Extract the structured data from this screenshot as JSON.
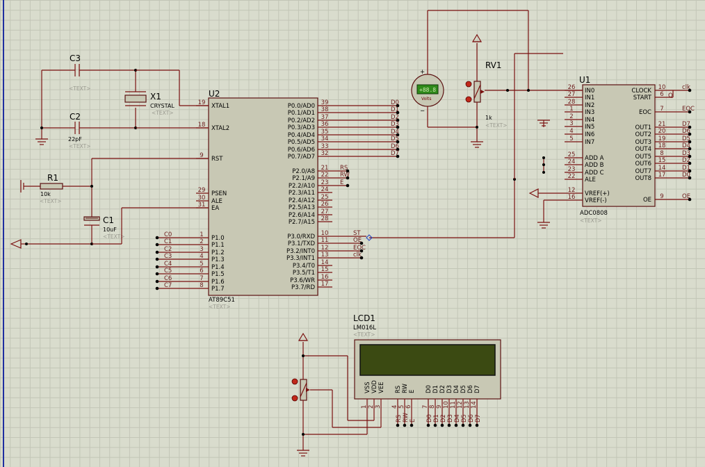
{
  "text_placeholder": "<TEXT>",
  "colors": {
    "wire": "#7a1010",
    "body": "#c8c8b4",
    "lcd": "#3b4a12",
    "meter": "#2f8a1a"
  },
  "c3": {
    "ref": "C3"
  },
  "c2": {
    "ref": "C2",
    "value": "22pF"
  },
  "x1": {
    "ref": "X1",
    "value": "CRYSTAL"
  },
  "r1": {
    "ref": "R1",
    "value": "10k"
  },
  "c1": {
    "ref": "C1",
    "value": "10uF"
  },
  "rv1": {
    "ref": "RV1",
    "value": "1k"
  },
  "voltmeter": {
    "reading": "+88.8",
    "unit": "Volts",
    "plus": "+",
    "minus": "−"
  },
  "u2": {
    "ref": "U2",
    "part": "AT89C51",
    "left_pins": [
      {
        "num": "19",
        "name": "XTAL1"
      },
      {
        "num": "18",
        "name": "XTAL2"
      },
      {
        "num": "9",
        "name": "RST"
      },
      {
        "num": "29",
        "name": "PSEN"
      },
      {
        "num": "30",
        "name": "ALE"
      },
      {
        "num": "31",
        "name": "EA"
      },
      {
        "num": "1",
        "name": "P1.0"
      },
      {
        "num": "2",
        "name": "P1.1"
      },
      {
        "num": "3",
        "name": "P1.2"
      },
      {
        "num": "4",
        "name": "P1.3"
      },
      {
        "num": "5",
        "name": "P1.4"
      },
      {
        "num": "6",
        "name": "P1.5"
      },
      {
        "num": "7",
        "name": "P1.6"
      },
      {
        "num": "8",
        "name": "P1.7"
      }
    ],
    "right_pins": [
      {
        "num": "39",
        "name": "P0.0/AD0",
        "net": "D0"
      },
      {
        "num": "38",
        "name": "P0.1/AD1",
        "net": "D1"
      },
      {
        "num": "37",
        "name": "P0.2/AD2",
        "net": "D2"
      },
      {
        "num": "36",
        "name": "P0.3/AD3",
        "net": "D3"
      },
      {
        "num": "35",
        "name": "P0.4/AD4",
        "net": "D4"
      },
      {
        "num": "34",
        "name": "P0.5/AD5",
        "net": "D5"
      },
      {
        "num": "33",
        "name": "P0.6/AD6",
        "net": "D6"
      },
      {
        "num": "32",
        "name": "P0.7/AD7",
        "net": "D7"
      },
      {
        "num": "21",
        "name": "P2.0/A8",
        "net": "RS"
      },
      {
        "num": "22",
        "name": "P2.1/A9",
        "net": "RW"
      },
      {
        "num": "23",
        "name": "P2.2/A10",
        "net": "E"
      },
      {
        "num": "24",
        "name": "P2.3/A11",
        "net": ""
      },
      {
        "num": "25",
        "name": "P2.4/A12",
        "net": ""
      },
      {
        "num": "26",
        "name": "P2.5/A13",
        "net": ""
      },
      {
        "num": "27",
        "name": "P2.6/A14",
        "net": ""
      },
      {
        "num": "28",
        "name": "P2.7/A15",
        "net": ""
      },
      {
        "num": "10",
        "name": "P3.0/RXD",
        "net": "ST"
      },
      {
        "num": "11",
        "name": "P3.1/TXD",
        "net": "OE"
      },
      {
        "num": "12",
        "name": "P3.2/INT0",
        "net": "EOC"
      },
      {
        "num": "13",
        "name": "P3.3/INT1",
        "net": "clk"
      },
      {
        "num": "14",
        "name": "P3.4/T0",
        "net": ""
      },
      {
        "num": "15",
        "name": "P3.5/T1",
        "net": ""
      },
      {
        "num": "16",
        "name": "P3.6/WR",
        "net": ""
      },
      {
        "num": "17",
        "name": "P3.7/RD",
        "net": ""
      }
    ],
    "p1_nets": [
      "C0",
      "C1",
      "C2",
      "C3",
      "C4",
      "C5",
      "C6",
      "C7"
    ]
  },
  "u1": {
    "ref": "U1",
    "part": "ADC0808",
    "left_pins": [
      {
        "num": "26",
        "name": "IN0"
      },
      {
        "num": "27",
        "name": "IN1"
      },
      {
        "num": "28",
        "name": "IN2"
      },
      {
        "num": "1",
        "name": "IN3"
      },
      {
        "num": "2",
        "name": "IN4"
      },
      {
        "num": "3",
        "name": "IN5"
      },
      {
        "num": "4",
        "name": "IN6"
      },
      {
        "num": "5",
        "name": "IN7"
      },
      {
        "num": "25",
        "name": "ADD A"
      },
      {
        "num": "24",
        "name": "ADD B"
      },
      {
        "num": "23",
        "name": "ADD C"
      },
      {
        "num": "22",
        "name": "ALE"
      },
      {
        "num": "12",
        "name": "VREF(+)"
      },
      {
        "num": "16",
        "name": "VREF(-)"
      }
    ],
    "right_pins": [
      {
        "num": "10",
        "name": "CLOCK",
        "net": "clk"
      },
      {
        "num": "6",
        "name": "START",
        "net": ""
      },
      {
        "num": "7",
        "name": "EOC",
        "net": "EOC"
      },
      {
        "num": "21",
        "name": "OUT1",
        "net": "D7"
      },
      {
        "num": "20",
        "name": "OUT2",
        "net": "D6"
      },
      {
        "num": "19",
        "name": "OUT3",
        "net": "D5"
      },
      {
        "num": "18",
        "name": "OUT4",
        "net": "D4"
      },
      {
        "num": "8",
        "name": "OUT5",
        "net": "D3"
      },
      {
        "num": "15",
        "name": "OUT6",
        "net": "D2"
      },
      {
        "num": "14",
        "name": "OUT7",
        "net": "D1"
      },
      {
        "num": "17",
        "name": "OUT8",
        "net": "D0"
      },
      {
        "num": "9",
        "name": "OE",
        "net": "OE"
      }
    ],
    "start_q": "Q"
  },
  "lcd1": {
    "ref": "LCD1",
    "part": "LM016L",
    "pins": [
      {
        "name": "VSS",
        "num": "1"
      },
      {
        "name": "VDD",
        "num": "2"
      },
      {
        "name": "VEE",
        "num": "3"
      },
      {
        "name": "RS",
        "num": "4"
      },
      {
        "name": "RW",
        "num": "5"
      },
      {
        "name": "E",
        "num": "6"
      },
      {
        "name": "D0",
        "num": "7"
      },
      {
        "name": "D1",
        "num": "8"
      },
      {
        "name": "D2",
        "num": "9"
      },
      {
        "name": "D3",
        "num": "10"
      },
      {
        "name": "D4",
        "num": "11"
      },
      {
        "name": "D5",
        "num": "12"
      },
      {
        "name": "D6",
        "num": "13"
      },
      {
        "name": "D7",
        "num": "14"
      }
    ],
    "bottom_nets": [
      "RS",
      "RW",
      "E",
      "D0",
      "D1",
      "D2",
      "D3",
      "D4",
      "D5",
      "D6",
      "D7"
    ]
  }
}
